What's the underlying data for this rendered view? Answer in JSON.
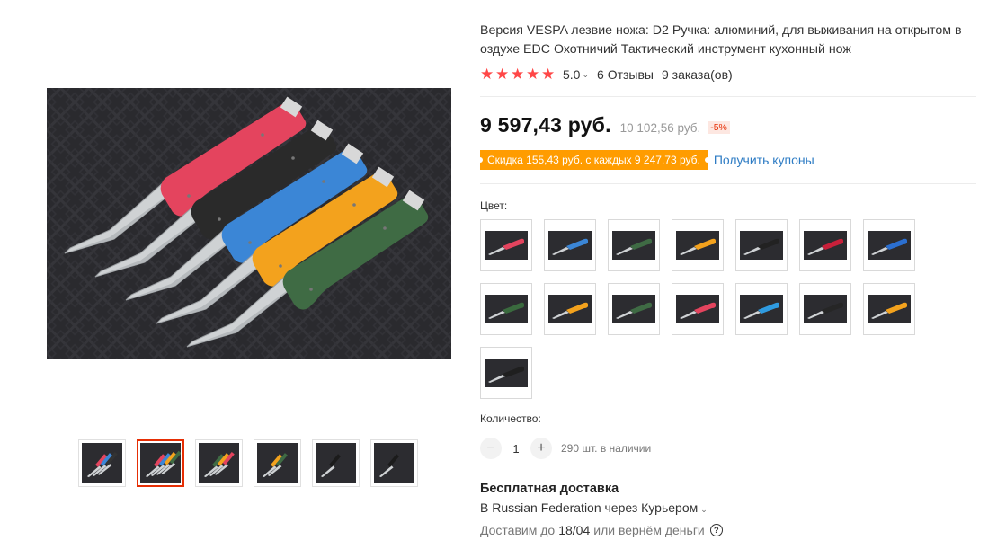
{
  "product": {
    "title": "Версия VESPA лезвие ножа: D2 Ручка: алюминий, для выживания на открытом в оздухе EDC Охотничий Тактический инструмент кухонный нож",
    "rating_value": "5.0",
    "reviews": "6 Отзывы",
    "orders": "9 заказа(ов)",
    "price": "9 597,43 руб.",
    "old_price": "10 102,56 руб.",
    "discount": "-5%",
    "coupon_text": "Скидка 155,43 руб. с каждых 9 247,73 руб.",
    "coupon_link": "Получить купоны"
  },
  "colors": {
    "accent": "#e62e04",
    "star": "#ff4747",
    "coupon_bg": "#ff9c00",
    "link": "#2e7cc4"
  },
  "gallery": {
    "thumbnails": [
      {
        "name": "thumb-1",
        "palette": [
          "#e4445e",
          "#3b86d6",
          "#333333"
        ]
      },
      {
        "name": "thumb-2",
        "palette": [
          "#e4445e",
          "#3b86d6",
          "#f3a21d",
          "#3f6b44"
        ]
      },
      {
        "name": "thumb-3",
        "palette": [
          "#3f6b44",
          "#f3a21d",
          "#e4445e"
        ]
      },
      {
        "name": "thumb-4",
        "palette": [
          "#f3a21d",
          "#3f6b44"
        ]
      },
      {
        "name": "thumb-5",
        "palette": [
          "#1b1b1b"
        ]
      },
      {
        "name": "thumb-6",
        "palette": [
          "#1b1b1b"
        ]
      }
    ],
    "active_index": 1
  },
  "color_section": {
    "label": "Цвет:",
    "options": [
      {
        "name": "pink",
        "handle": "#e4445e"
      },
      {
        "name": "blue",
        "handle": "#3b86d6"
      },
      {
        "name": "green",
        "handle": "#3f6b44"
      },
      {
        "name": "orange",
        "handle": "#f3a21d"
      },
      {
        "name": "black",
        "handle": "#222222"
      },
      {
        "name": "red",
        "handle": "#c8203a"
      },
      {
        "name": "blue-black-blade",
        "handle": "#2b6fd0"
      },
      {
        "name": "green-black-blade",
        "handle": "#3a6a3e"
      },
      {
        "name": "orange-black-blade",
        "handle": "#f3a21d"
      },
      {
        "name": "green-2",
        "handle": "#3f6b44"
      },
      {
        "name": "pink-black-blade",
        "handle": "#e4445e"
      },
      {
        "name": "cyan",
        "handle": "#2f9be0"
      },
      {
        "name": "black-2",
        "handle": "#262626"
      },
      {
        "name": "orange-2",
        "handle": "#f3a21d"
      },
      {
        "name": "black-3",
        "handle": "#1f1f1f"
      }
    ]
  },
  "quantity": {
    "label": "Количество:",
    "minus": "−",
    "plus": "+",
    "value": "1",
    "stock": "290 шт. в наличии"
  },
  "shipping": {
    "title": "Бесплатная доставка",
    "destination": "В Russian Federation через Курьером",
    "delivery_prefix": "Доставим до",
    "delivery_date": "18/04",
    "delivery_suffix": "или вернём деньги",
    "help": "?"
  },
  "icons": {
    "star": "★",
    "chevron": "⌄"
  }
}
